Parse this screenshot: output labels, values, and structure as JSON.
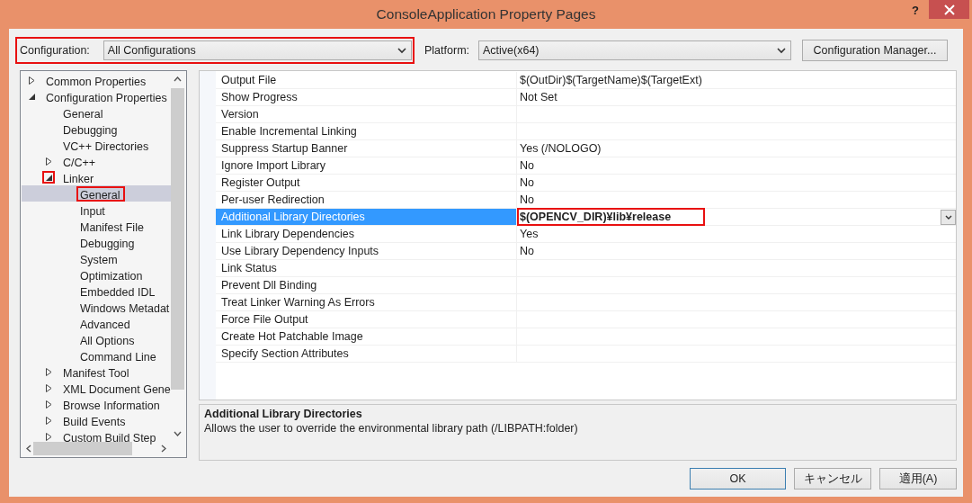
{
  "window": {
    "title": "ConsoleApplication Property Pages",
    "help": "?"
  },
  "configuration": {
    "label": "Configuration:",
    "value": "All Configurations",
    "highlighted": true
  },
  "platform": {
    "label": "Platform:",
    "value": "Active(x64)"
  },
  "configuration_manager_button": "Configuration Manager...",
  "tree": [
    {
      "label": "Common Properties",
      "expanded": false,
      "selected": false
    },
    {
      "label": "Configuration Properties",
      "expanded": true,
      "selected": false,
      "children": [
        {
          "label": "General",
          "selected": false
        },
        {
          "label": "Debugging",
          "selected": false
        },
        {
          "label": "VC++ Directories",
          "selected": false
        },
        {
          "label": "C/C++",
          "expanded": false,
          "selected": false
        },
        {
          "label": "Linker",
          "expanded": true,
          "selected": false,
          "expander_highlighted": true,
          "children": [
            {
              "label": "General",
              "selected": true,
              "highlighted": true
            },
            {
              "label": "Input",
              "selected": false
            },
            {
              "label": "Manifest File",
              "selected": false
            },
            {
              "label": "Debugging",
              "selected": false
            },
            {
              "label": "System",
              "selected": false
            },
            {
              "label": "Optimization",
              "selected": false
            },
            {
              "label": "Embedded IDL",
              "selected": false
            },
            {
              "label": "Windows Metadat",
              "selected": false
            },
            {
              "label": "Advanced",
              "selected": false
            },
            {
              "label": "All Options",
              "selected": false
            },
            {
              "label": "Command Line",
              "selected": false
            }
          ]
        },
        {
          "label": "Manifest Tool",
          "expanded": false,
          "selected": false
        },
        {
          "label": "XML Document Gene",
          "expanded": false,
          "selected": false
        },
        {
          "label": "Browse Information",
          "expanded": false,
          "selected": false
        },
        {
          "label": "Build Events",
          "expanded": false,
          "selected": false
        },
        {
          "label": "Custom Build Step",
          "expanded": false,
          "selected": false
        }
      ]
    }
  ],
  "properties": [
    {
      "name": "Output File",
      "value": "$(OutDir)$(TargetName)$(TargetExt)",
      "selected": false
    },
    {
      "name": "Show Progress",
      "value": "Not Set",
      "selected": false
    },
    {
      "name": "Version",
      "selected": false
    },
    {
      "name": "Enable Incremental Linking",
      "selected": false
    },
    {
      "name": "Suppress Startup Banner",
      "value": "Yes (/NOLOGO)",
      "selected": false
    },
    {
      "name": "Ignore Import Library",
      "value": "No",
      "selected": false
    },
    {
      "name": "Register Output",
      "value": "No",
      "selected": false
    },
    {
      "name": "Per-user Redirection",
      "value": "No",
      "selected": false
    },
    {
      "name": "Additional Library Directories",
      "value": "$(OPENCV_DIR)¥lib¥release",
      "selected": true,
      "highlighted": true
    },
    {
      "name": "Link Library Dependencies",
      "value": "Yes",
      "selected": false
    },
    {
      "name": "Use Library Dependency Inputs",
      "value": "No",
      "selected": false
    },
    {
      "name": "Link Status",
      "selected": false
    },
    {
      "name": "Prevent Dll Binding",
      "selected": false
    },
    {
      "name": "Treat Linker Warning As Errors",
      "selected": false
    },
    {
      "name": "Force File Output",
      "selected": false
    },
    {
      "name": "Create Hot Patchable Image",
      "selected": false
    },
    {
      "name": "Specify Section Attributes",
      "selected": false
    }
  ],
  "description": {
    "title": "Additional Library Directories",
    "text": "Allows the user to override the environmental library path (/LIBPATH:folder)"
  },
  "buttons": [
    {
      "label": "OK",
      "default": true
    },
    {
      "label": "キャンセル",
      "default": false
    },
    {
      "label": "適用(A)",
      "default": false
    }
  ]
}
